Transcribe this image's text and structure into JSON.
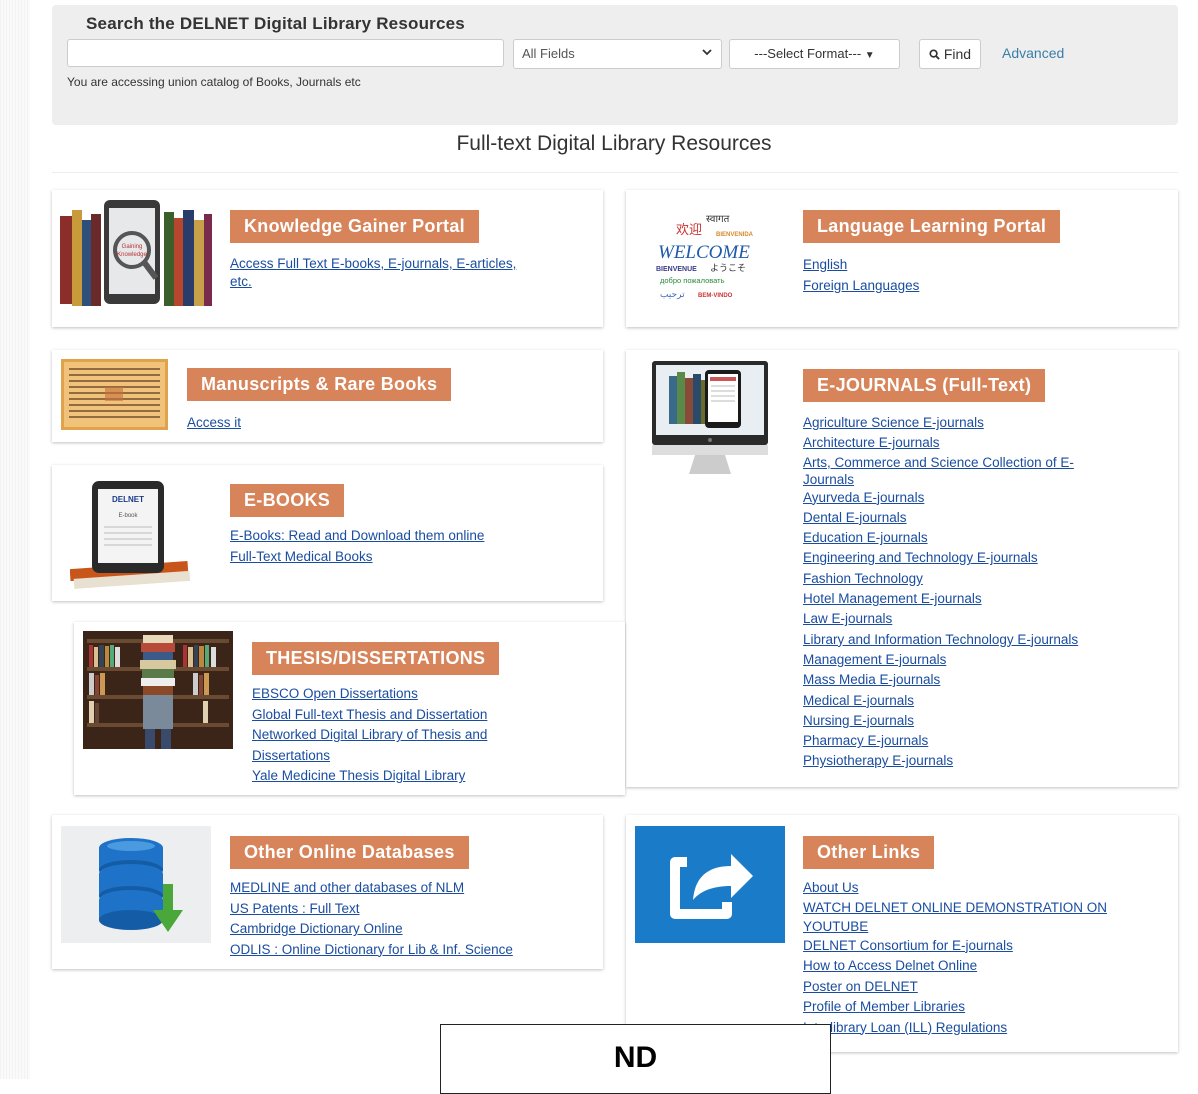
{
  "search": {
    "title": "Search the DELNET Digital Library Resources",
    "input_value": "",
    "input_placeholder": "",
    "field_select": "All Fields",
    "format_select": "---Select Format---",
    "find_label": "Find",
    "advanced_label": "Advanced",
    "note": "You are accessing union catalog of Books, Journals etc"
  },
  "section_title": "Full-text Digital Library Resources",
  "cards": {
    "knowledge": {
      "title": "Knowledge Gainer Portal",
      "links": [
        "Access Full Text E-books, E-journals, E-articles,",
        "etc."
      ]
    },
    "language": {
      "title": "Language Learning Portal",
      "links": [
        "English",
        "Foreign Languages"
      ],
      "image_words": [
        "WELCOME",
        "欢迎",
        "BIENVENIDA",
        "स्वागत",
        "BIENVENUE",
        "ようこそ",
        "добро пожаловать",
        "ترحيب",
        "BEM-VINDO"
      ]
    },
    "manuscripts": {
      "title": "Manuscripts & Rare Books",
      "links": [
        "Access it"
      ]
    },
    "ejournals": {
      "title": "E-JOURNALS (Full-Text)",
      "links": [
        "Agriculture Science E-journals",
        "Architecture E-journals",
        "Arts, Commerce and Science Collection of E-",
        "Journals",
        "Ayurveda E-journals",
        "Dental E-journals",
        "Education E-journals",
        "Engineering and Technology E-journals",
        "Fashion Technology",
        "Hotel Management E-journals",
        "Law E-journals",
        "Library and Information Technology E-journals",
        "Management E-journals",
        "Mass Media E-journals",
        "Medical E-journals",
        "Nursing E-journals",
        "Pharmacy E-journals",
        "Physiotherapy E-journals"
      ]
    },
    "ebooks": {
      "title": "E-BOOKS",
      "links": [
        "E-Books: Read and Download them online",
        "Full-Text Medical Books"
      ],
      "device_brand": "DELNET",
      "device_text": "E-book"
    },
    "thesis": {
      "title": "THESIS/DISSERTATIONS",
      "links": [
        "EBSCO Open Dissertations",
        "Global Full-text Thesis and Dissertation",
        "Networked Digital Library of Thesis and",
        "Dissertations",
        "Yale Medicine Thesis Digital Library"
      ]
    },
    "databases": {
      "title": "Other Online Databases",
      "links": [
        "MEDLINE and other databases of NLM",
        "US Patents : Full Text",
        "Cambridge Dictionary Online",
        "ODLIS : Online Dictionary for Lib & Inf. Science"
      ]
    },
    "otherlinks": {
      "title": "Other Links",
      "links": [
        "About Us",
        "WATCH DELNET ONLINE DEMONSTRATION ON",
        "YOUTUBE",
        "DELNET Consortium for E-journals",
        "How to Access Delnet Online",
        "Poster on DELNET",
        "Profile of Member Libraries",
        "Interlibrary Loan (ILL) Regulations"
      ]
    }
  },
  "overlay_text": "ND",
  "colors": {
    "accent": "#d8845a",
    "link": "#1a4da1",
    "search_bg": "#eeeeee"
  }
}
